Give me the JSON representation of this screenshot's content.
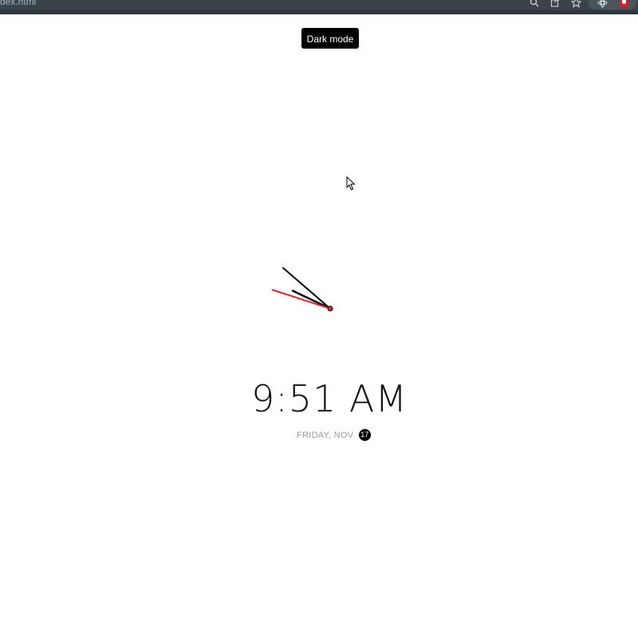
{
  "browser": {
    "url_fragment": "dex.html",
    "icons": [
      "search-icon",
      "share-icon",
      "star-icon",
      "extensions-icon",
      "profile-icon"
    ]
  },
  "controls": {
    "dark_mode_label": "Dark mode"
  },
  "clock": {
    "hour": 9,
    "minute": 51,
    "second": 48
  },
  "time_display": "9:51 AM",
  "date": {
    "prefix": "FRIDAY, NOV",
    "day": "17"
  },
  "colors": {
    "browser_bar": "#3a4448",
    "button_bg": "#000000",
    "second_hand": "#e0262d",
    "hands": "#000000",
    "date_text": "#9a9a9a"
  }
}
